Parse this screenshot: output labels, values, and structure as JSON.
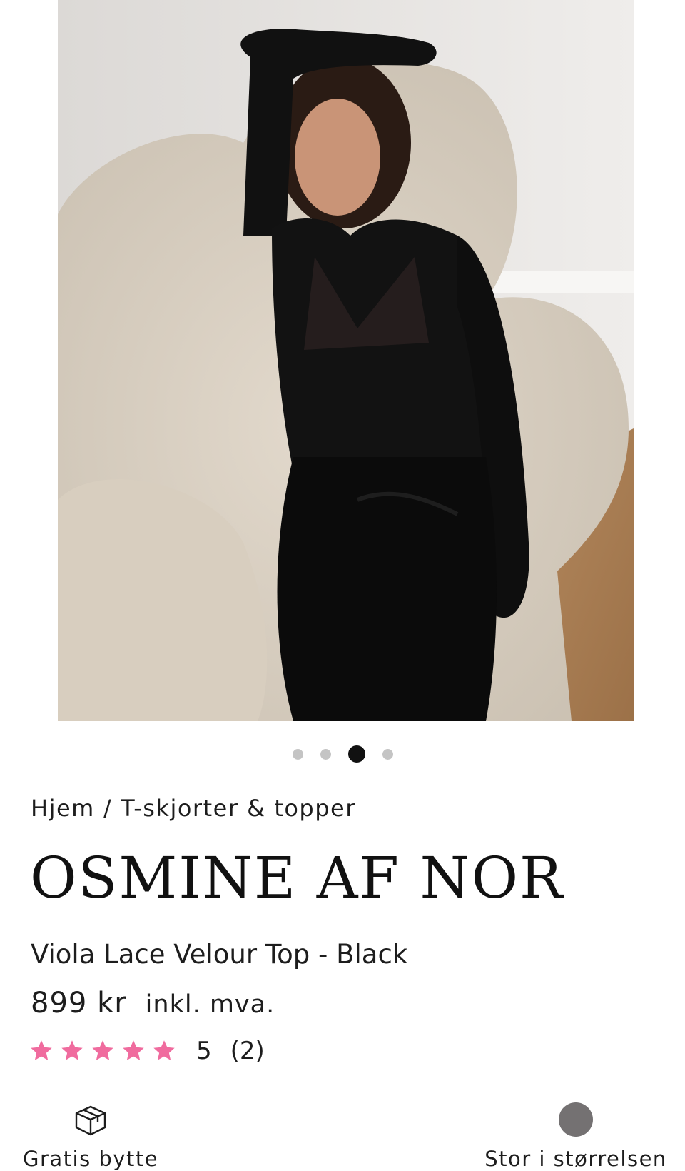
{
  "carousel": {
    "dots": [
      {
        "active": false
      },
      {
        "active": false
      },
      {
        "active": true
      },
      {
        "active": false
      }
    ]
  },
  "breadcrumb": {
    "home": "Hjem",
    "separator": "/",
    "category": "T-skjorter & topper"
  },
  "product": {
    "brand": "OSMINE AF NOR",
    "name": "Viola Lace Velour Top - Black",
    "price": "899 kr",
    "vat_note": "inkl. mva.",
    "rating_value": "5",
    "rating_count": "(2)",
    "stars": 5,
    "star_color": "#f06b9e"
  },
  "features": {
    "exchange_label": "Gratis bytte",
    "exchange_icon": "package-icon",
    "size_label": "Stor i størrelsen",
    "size_icon": "size-indicator-icon",
    "size_color": "#747172"
  }
}
